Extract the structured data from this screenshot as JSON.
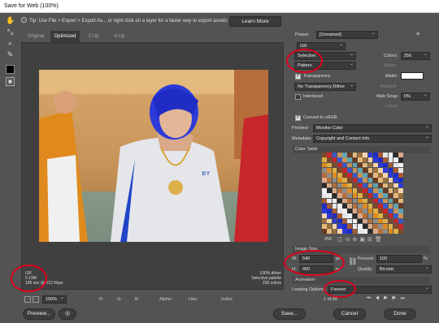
{
  "window": {
    "title": "Save for Web (100%)"
  },
  "tip": {
    "text": "Tip: Use File > Export > Export As... or right click on a layer for a faster way to export assets",
    "learn_more": "Learn More"
  },
  "tabs": [
    "Original",
    "Optimized",
    "2-Up",
    "4-Up"
  ],
  "info_left": [
    "GIF",
    "5.19M",
    "105 sec @ 512 Kbps"
  ],
  "info_right": [
    "100% dither",
    "Selective palette",
    "256 colors"
  ],
  "statusbar": {
    "zoom": "100%",
    "r": "R:",
    "g": "G:",
    "b": "B:",
    "alpha": "Alpha:",
    "hex": "Hex:",
    "index": "Index:"
  },
  "buttons": {
    "preview": "Preview...",
    "save": "Save...",
    "cancel": "Cancel",
    "done": "Done"
  },
  "right": {
    "preset_label": "Preset:",
    "preset_value": "[Unnamed]",
    "format": "GIF",
    "reduction": "Selective",
    "colors_label": "Colors:",
    "colors_value": "256",
    "dither": "Pattern",
    "dither_pct_label": "Dither:",
    "transparency": "Transparency",
    "matte_label": "Matte:",
    "trans_dither": "No Transparency Dither",
    "amount_label": "Amount:",
    "interlaced": "Interlaced",
    "websnap_label": "Web Snap:",
    "websnap_value": "0%",
    "lossy_label": "Lossy:",
    "convert_srgb": "Convert to sRGB",
    "preview_label": "Preview:",
    "preview_value": "Monitor Color",
    "metadata_label": "Metadata:",
    "metadata_value": "Copyright and Contact Info",
    "color_table": "Color Table",
    "color_count": "256",
    "image_size": "Image Size",
    "w_label": "W:",
    "w_value": "540",
    "h_label": "H:",
    "h_value": "400",
    "px": "px",
    "percent_label": "Percent:",
    "percent_value": "100",
    "pct": "%",
    "quality_label": "Quality:",
    "quality_value": "Bicubic",
    "animation": "Animation",
    "looping_label": "Looping Options:",
    "looping_value": "Forever",
    "frame_counter": "1 of 69"
  },
  "colors": {
    "highlight": "#e0001b",
    "panel": "#535353"
  }
}
